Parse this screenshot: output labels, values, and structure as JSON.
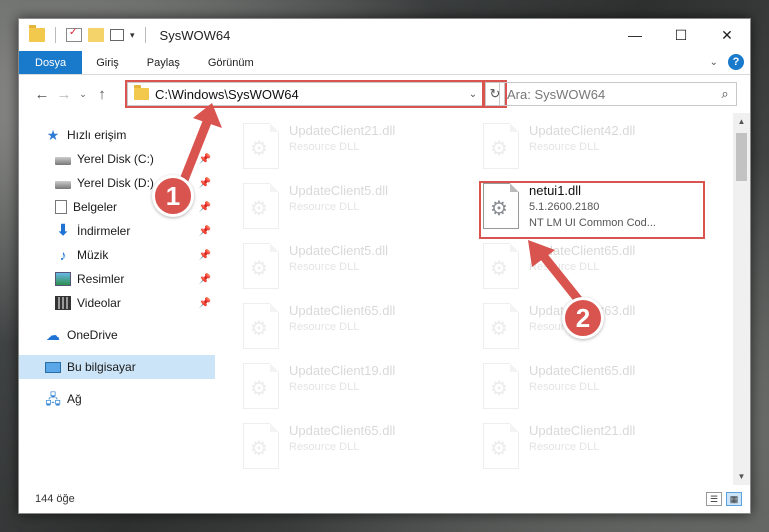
{
  "window": {
    "title": "SysWOW64",
    "controls": {
      "minimize": "—",
      "maximize": "☐",
      "close": "✕"
    }
  },
  "ribbon": {
    "tabs": [
      "Dosya",
      "Giriş",
      "Paylaş",
      "Görünüm"
    ],
    "help": "?"
  },
  "address": {
    "path": "C:\\Windows\\SysWOW64",
    "search_placeholder": "Ara: SysWOW64"
  },
  "nav": {
    "quick_access": "Hızlı erişim",
    "items": [
      {
        "label": "Yerel Disk (C:)",
        "icon": "drive-icon"
      },
      {
        "label": "Yerel Disk (D:)",
        "icon": "drive-icon"
      },
      {
        "label": "Belgeler",
        "icon": "documents-icon"
      },
      {
        "label": "İndirmeler",
        "icon": "downloads-icon"
      },
      {
        "label": "Müzik",
        "icon": "music-icon"
      },
      {
        "label": "Resimler",
        "icon": "pictures-icon"
      },
      {
        "label": "Videolar",
        "icon": "videos-icon"
      }
    ],
    "onedrive": "OneDrive",
    "this_pc": "Bu bilgisayar",
    "network": "Ağ"
  },
  "files": {
    "faded": [
      {
        "name": "UpdateClient21.dll",
        "sub": "Resource DLL"
      },
      {
        "name": "UpdateClient42.dll",
        "sub": "Resource DLL"
      },
      {
        "name": "UpdateClient5.dll",
        "sub": "Resource DLL"
      },
      {
        "name": "UpdateClient5.dll",
        "sub": "Resource DLL"
      },
      {
        "name": "UpdateClient65.dll",
        "sub": "Resource DLL"
      },
      {
        "name": "UpdateClient65.dll",
        "sub": "Resource DLL"
      },
      {
        "name": "UpdateClient63.dll",
        "sub": "Resource DLL"
      },
      {
        "name": "UpdateClient19.dll",
        "sub": "Resource DLL"
      },
      {
        "name": "UpdateClient65.dll",
        "sub": "Resource DLL"
      },
      {
        "name": "UpdateClient65.dll",
        "sub": "Resource DLL"
      },
      {
        "name": "UpdateClient21.dll",
        "sub": "Resource DLL"
      }
    ],
    "highlighted": {
      "name": "netui1.dll",
      "version": "5.1.2600.2180",
      "description": "NT LM UI Common Cod..."
    }
  },
  "status": {
    "count": "144 öğe"
  },
  "annotations": {
    "step1": "1",
    "step2": "2",
    "color": "#d9534f"
  }
}
